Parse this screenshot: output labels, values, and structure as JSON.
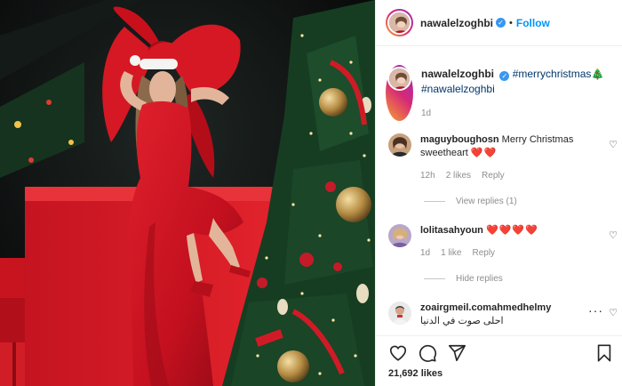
{
  "header": {
    "username": "nawalelzoghbi",
    "follow_label": "Follow",
    "separator": "•"
  },
  "caption": {
    "username": "nawalelzoghbi",
    "tags": [
      "#merrychristmas🎄",
      "#nawalelzoghbi"
    ],
    "time": "1d"
  },
  "comments": [
    {
      "username": "maguyboughosn",
      "text": "Merry Christmas sweetheart",
      "emoji": "❤️❤️",
      "time": "12h",
      "likes": "2 likes",
      "reply_label": "Reply",
      "replies_toggle": "View replies (1)"
    },
    {
      "username": "lolitasahyoun",
      "text": "",
      "emoji": "❤️❤️❤️❤️",
      "time": "1d",
      "likes": "1 like",
      "reply_label": "Reply",
      "replies_toggle": "Hide replies"
    },
    {
      "username": "zoairgmeil.comahmedhelmy",
      "text": "احلى صوت في الدنيا"
    }
  ],
  "likes_count": "21,692 likes",
  "icons": {
    "verified": "verified-badge-icon",
    "heart": "heart-icon",
    "comment": "comment-icon",
    "share": "share-icon",
    "save": "bookmark-icon",
    "more": "more-options-icon"
  },
  "colors": {
    "accent": "#0095f6",
    "verified": "#3897f0",
    "dress_red": "#c8102e"
  }
}
